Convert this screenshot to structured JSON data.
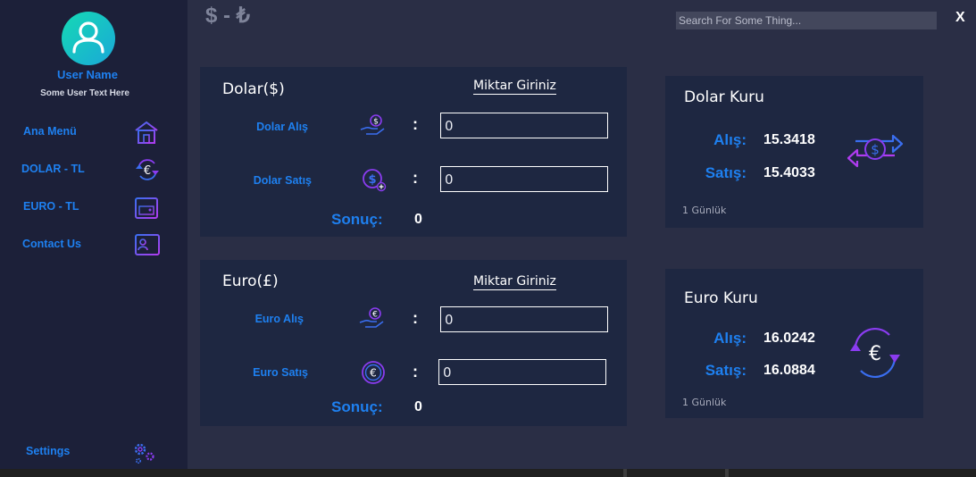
{
  "app": {
    "title": "$ - ₺",
    "close_label": "X",
    "search_placeholder": "Search For Some Thing...",
    "search_value": ""
  },
  "user": {
    "name": "User Name",
    "subtitle": "Some User Text Here"
  },
  "sidebar": {
    "items": [
      {
        "label": "Ana Menü",
        "icon": "home-icon"
      },
      {
        "label": "DOLAR - TL",
        "icon": "euro-exchange-icon"
      },
      {
        "label": "EURO - TL",
        "icon": "calendar-icon"
      },
      {
        "label": "Contact Us",
        "icon": "contact-card-icon"
      }
    ],
    "settings_label": "Settings",
    "settings_icon": "gears-icon"
  },
  "dolar_panel": {
    "title": "Dolar($)",
    "miktar_label": "Miktar Giriniz",
    "buy_label": "Dolar Alış",
    "sell_label": "Dolar Satış",
    "colon": ":",
    "buy_value": "0",
    "sell_value": "0",
    "result_label": "Sonuç:",
    "result_value": "0"
  },
  "euro_panel": {
    "title": "Euro(£)",
    "miktar_label": "Miktar Giriniz",
    "buy_label": "Euro Alış",
    "sell_label": "Euro Satış",
    "colon": ":",
    "buy_value": "0",
    "sell_value": "0",
    "result_label": "Sonuç:",
    "result_value": "0"
  },
  "dolar_rate": {
    "title": "Dolar Kuru",
    "buy_label": "Alış:",
    "buy_value": "15.3418",
    "sell_label": "Satış:",
    "sell_value": "15.4033",
    "period": "1 Günlük"
  },
  "euro_rate": {
    "title": "Euro Kuru",
    "buy_label": "Alış:",
    "buy_value": "16.0242",
    "sell_label": "Satış:",
    "sell_value": "16.0884",
    "period": "1 Günlük"
  },
  "colors": {
    "accent_blue": "#1e80f0",
    "icon_purple": "#8a3cf0",
    "icon_blue": "#3a6ef0",
    "avatar_teal": "#15d9b4",
    "sidebar_bg": "#1c2039",
    "panel_bg": "#1e2741",
    "page_bg": "#2a2e45"
  }
}
